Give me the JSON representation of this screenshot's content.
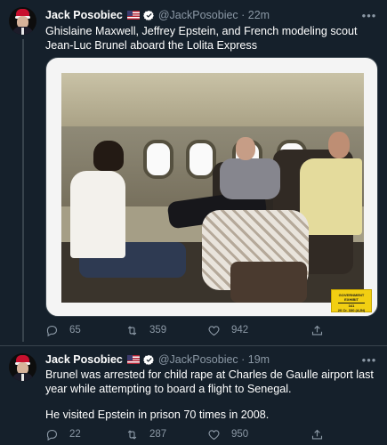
{
  "tweets": [
    {
      "author_name": "Jack Posobiec",
      "handle_time": "@JackPosobiec · 22m",
      "text": "Ghislaine Maxwell, Jeffrey Epstein, and French modeling scout Jean-Luc Brunel aboard the Lolita Express",
      "media": {
        "exhibit_label_1": "GOVERNMENT",
        "exhibit_label_2": "EXHIBIT",
        "exhibit_label_3": "341",
        "exhibit_label_4": "20 Cr. 330 (AJN)"
      },
      "replies": "65",
      "retweets": "359",
      "likes": "942"
    },
    {
      "author_name": "Jack Posobiec",
      "handle_time": "@JackPosobiec · 19m",
      "text_1": "Brunel was arrested for child rape at Charles de Gaulle airport last year while attempting to board a flight to Senegal.",
      "text_2": "He visited Epstein in prison 70 times in 2008.",
      "replies": "22",
      "retweets": "287",
      "likes": "950"
    }
  ],
  "colors": {
    "background": "#15202b",
    "muted": "#8b98a5",
    "verified": "#1d9bf0",
    "divider": "#38444d"
  },
  "icons": [
    "reply-icon",
    "retweet-icon",
    "like-icon",
    "share-icon",
    "more-icon",
    "verified-icon",
    "us-flag-icon"
  ]
}
